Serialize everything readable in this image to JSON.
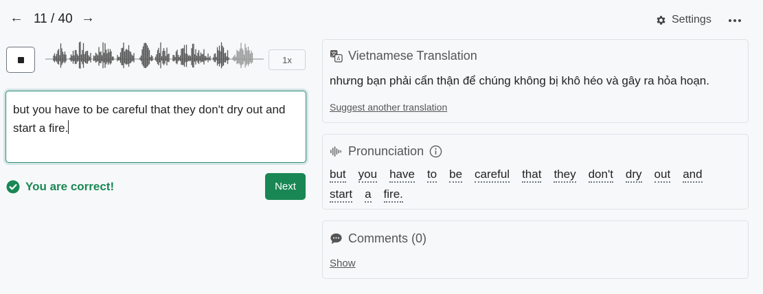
{
  "nav": {
    "prev_icon": "arrow-left-icon",
    "prev_glyph": "←",
    "counter": "11 / 40",
    "next_icon": "arrow-right-icon",
    "next_glyph": "→",
    "settings_label": "Settings",
    "settings_icon": "gear-icon",
    "more_icon": "more-horizontal-icon"
  },
  "audio": {
    "stop_icon": "stop-icon",
    "waveform_icon": "waveform",
    "speed_label": "1x"
  },
  "answer": {
    "value": "but you have to be careful that they don't dry out and start a fire."
  },
  "result": {
    "icon": "check-circle-icon",
    "message": "You are correct!",
    "next_label": "Next"
  },
  "translation": {
    "icon": "translate-icon",
    "title": "Vietnamese Translation",
    "text": "nhưng bạn phải cẩn thận để chúng không bị khô héo và gây ra hỏa hoạn.",
    "suggest_link": "Suggest another translation"
  },
  "pronunciation": {
    "icon": "audio-waves-icon",
    "title": "Pronunciation",
    "info_icon": "info-icon",
    "words": [
      "but",
      "you",
      "have",
      "to",
      "be",
      "careful",
      "that",
      "they",
      "don't",
      "dry",
      "out",
      "and",
      "start",
      "a",
      "fire."
    ]
  },
  "comments": {
    "icon": "chat-bubble-icon",
    "title": "Comments (0)",
    "show_link": "Show"
  },
  "colors": {
    "accent_green": "#198754",
    "focus_border": "#2e8b7a",
    "card_border": "#dee2e6",
    "background": "#f7f8fa"
  }
}
